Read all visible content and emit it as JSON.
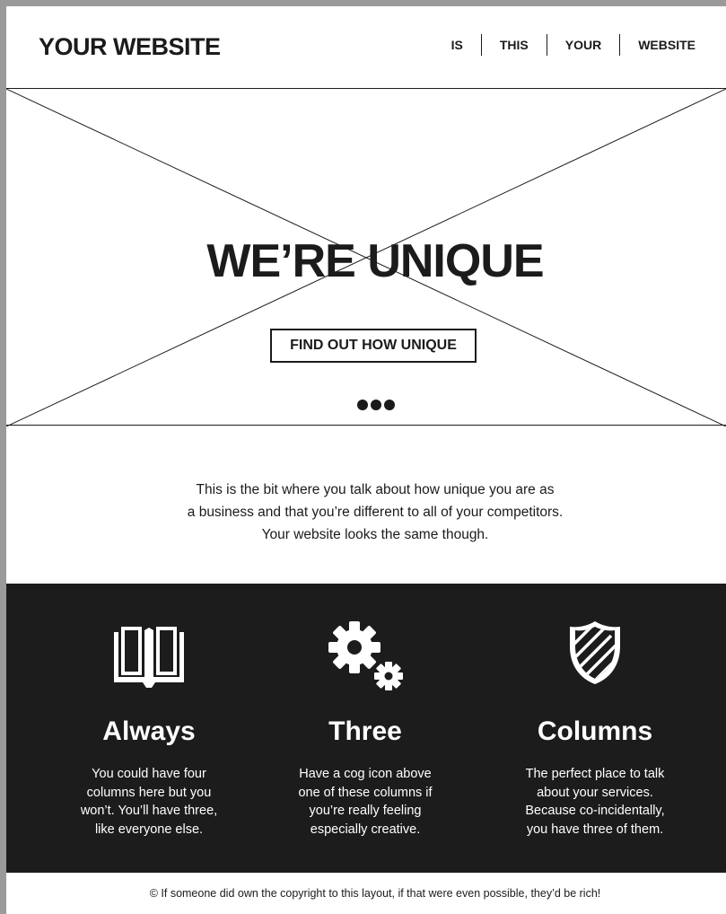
{
  "header": {
    "logo": "YOUR WEBSITE",
    "nav": [
      "IS",
      "THIS",
      "YOUR",
      "WEBSITE"
    ]
  },
  "hero": {
    "title": "WE’RE UNIQUE",
    "button_label": "FIND OUT HOW UNIQUE",
    "slides": 3
  },
  "intro": {
    "lines": [
      "This is the bit where you talk about how unique you are as",
      "a business and that you’re different to all of your competitors.",
      "Your website looks the same though."
    ]
  },
  "features": {
    "columns": [
      {
        "icon": "book-icon",
        "title": "Always",
        "lines": [
          "You could have four",
          "columns here but you",
          "won’t. You’ll have three,",
          "like everyone else."
        ]
      },
      {
        "icon": "gears-icon",
        "title": "Three",
        "lines": [
          "Have a cog icon above",
          "one of these columns if",
          "you’re really feeling",
          "especially creative."
        ]
      },
      {
        "icon": "shield-icon",
        "title": "Columns",
        "lines": [
          "The perfect place to talk",
          "about your services.",
          "Because co-incidentally,",
          "you have three of them."
        ]
      }
    ]
  },
  "footer": {
    "copyright": "© If someone did own the copyright to this layout, if that were even possible, they’d be rich!"
  },
  "colors": {
    "page_bg": "#ffffff",
    "frame": "#9a9a9a",
    "dark_section": "#1c1c1c",
    "ink": "#1b1b1b"
  }
}
